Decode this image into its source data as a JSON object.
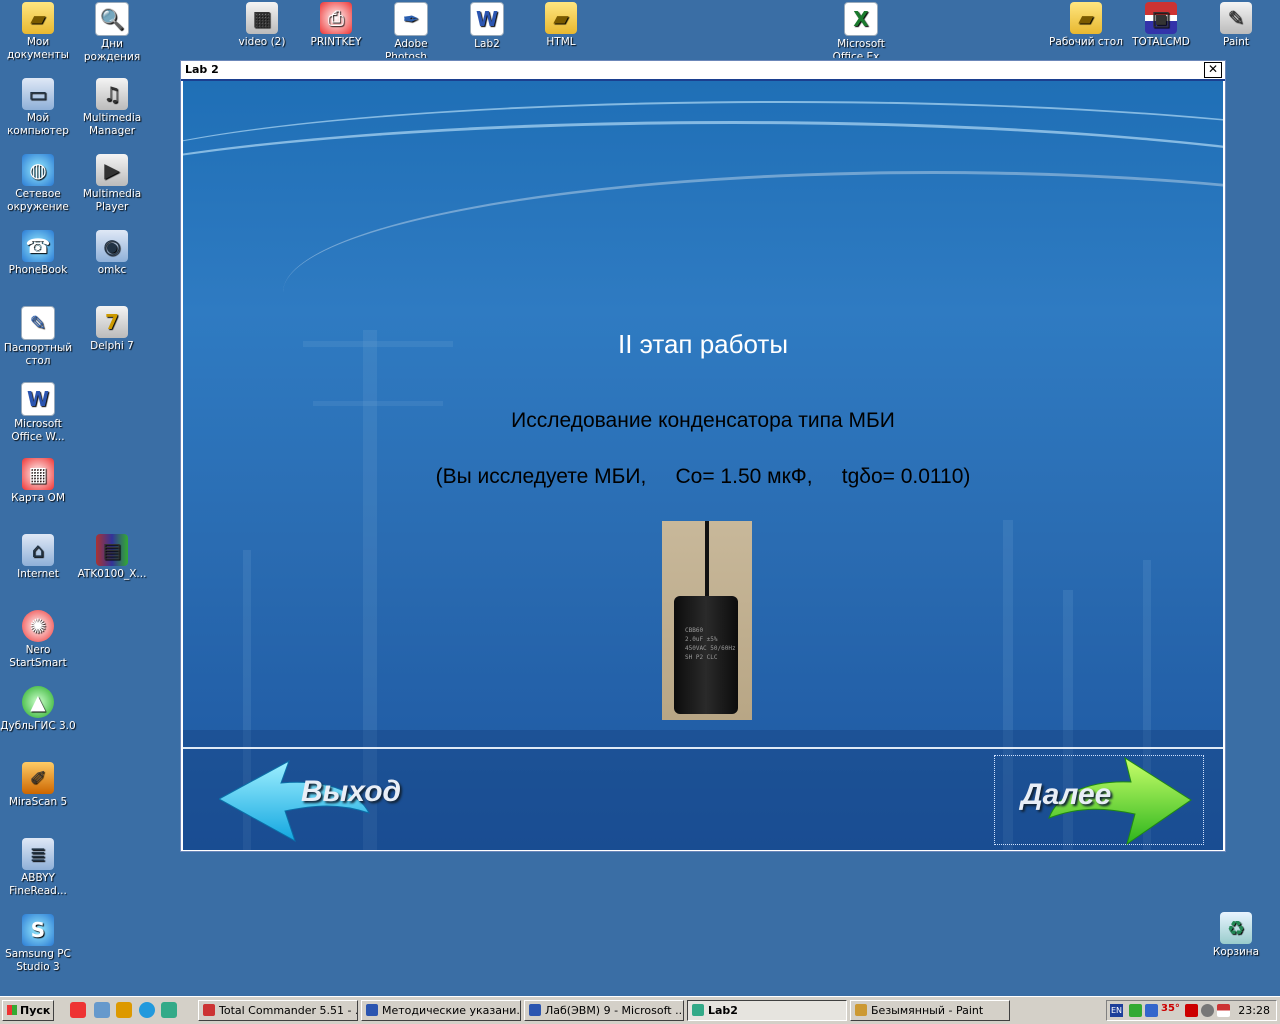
{
  "desktop": {
    "icons_left": [
      {
        "label": "Мои документы",
        "icon": "folder-icon"
      },
      {
        "label": "Дни рождения",
        "icon": "document-icon"
      },
      {
        "label": "Мой компьютер",
        "icon": "computer-icon"
      },
      {
        "label": "Multimedia Manager",
        "icon": "multimedia-icon"
      },
      {
        "label": "Сетевое окружение",
        "icon": "network-icon"
      },
      {
        "label": "Multimedia Player",
        "icon": "player-icon"
      },
      {
        "label": "PhoneBook",
        "icon": "phone-icon"
      },
      {
        "label": "omkc",
        "icon": "network-pc-icon"
      },
      {
        "label": "Паспортный стол",
        "icon": "document-icon"
      },
      {
        "label": "Delphi 7",
        "icon": "delphi-icon"
      },
      {
        "label": "Microsoft Office W...",
        "icon": "word-icon"
      },
      {
        "label": "Карта ОМ",
        "icon": "map-icon"
      },
      {
        "label": "Internet",
        "icon": "internet-icon"
      },
      {
        "label": "ATK0100_X...",
        "icon": "archive-icon"
      },
      {
        "label": "Nero StartSmart",
        "icon": "nero-icon"
      },
      {
        "label": "ДубльГИС 3.0",
        "icon": "dublgis-icon"
      },
      {
        "label": "MiraScan 5",
        "icon": "scanner-icon"
      },
      {
        "label": "ABBYY FineRead...",
        "icon": "abbyy-icon"
      },
      {
        "label": "Samsung PC Studio 3",
        "icon": "samsung-icon"
      }
    ],
    "icons_top": [
      {
        "label": "video (2)",
        "icon": "video-icon"
      },
      {
        "label": "PRINTKEY",
        "icon": "printkey-icon"
      },
      {
        "label": "Adobe Photosh...",
        "icon": "photoshop-icon"
      },
      {
        "label": "Lab2",
        "icon": "word-icon"
      },
      {
        "label": "HTML",
        "icon": "folder-icon"
      },
      {
        "label": "Microsoft Office Ex...",
        "icon": "excel-icon"
      },
      {
        "label": "Рабочий стол",
        "icon": "folder-icon"
      },
      {
        "label": "TOTALCMD",
        "icon": "floppy-icon"
      },
      {
        "label": "Paint",
        "icon": "paint-icon"
      }
    ],
    "recycle_bin": "Корзина"
  },
  "window": {
    "title": "Lab 2",
    "close_glyph": "✕",
    "stage_title": "II этап работы",
    "subtitle": "Исследование конденсатора типа МБИ",
    "params_line": "(Вы исследуете МБИ,     Co= 1.50 мкФ,     tgδo= 0.0110)",
    "photo_label": "CBB60\n2.0uF ±5%\n450VAC 50/60Hz\nSH P2 CLC",
    "exit_label": "Выход",
    "next_label": "Далее"
  },
  "taskbar": {
    "start_label": "Пуск",
    "tasks": [
      {
        "label": "Total Commander 5.51 - ...",
        "active": false
      },
      {
        "label": "Методические указани...",
        "active": false
      },
      {
        "label": "Лаб(ЭВМ) 9 - Microsoft ...",
        "active": false
      },
      {
        "label": "Lab2",
        "active": true
      },
      {
        "label": "Безымянный - Paint",
        "active": false
      }
    ],
    "tray": {
      "lang": "EN",
      "temp": "35°",
      "clock": "23:28"
    }
  }
}
